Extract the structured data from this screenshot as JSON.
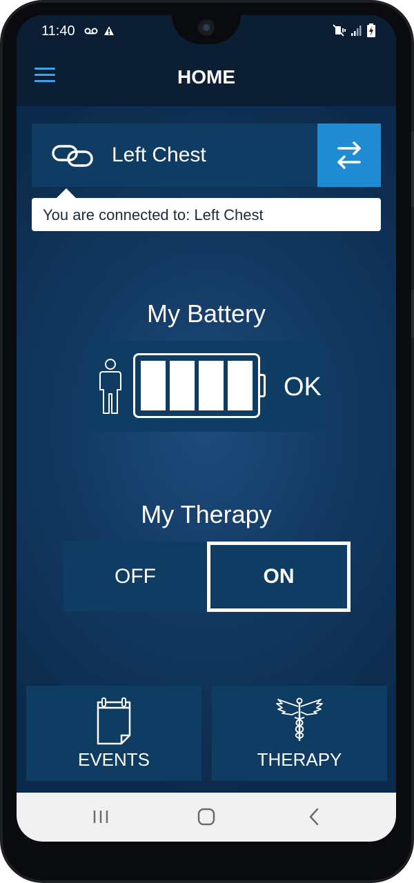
{
  "status_bar": {
    "time": "11:40",
    "left_icons": [
      "voicemail-icon",
      "alert-icon"
    ],
    "right_icons": [
      "mute-vibrate-icon",
      "signal-icon",
      "battery-charging-icon"
    ]
  },
  "app_bar": {
    "title": "HOME",
    "menu_icon": "hamburger-menu-icon"
  },
  "device": {
    "icon": "link-icon",
    "name": "Left Chest",
    "swap_icon": "swap-arrows-icon",
    "tooltip": "You are connected to: Left Chest"
  },
  "battery": {
    "title": "My Battery",
    "person_icon": "person-icon",
    "level_fraction": 1.0,
    "cells_filled": 4,
    "cells_total": 4,
    "status": "OK"
  },
  "therapy": {
    "title": "My Therapy",
    "off_label": "OFF",
    "on_label": "ON",
    "selected": "ON"
  },
  "tiles": [
    {
      "label": "EVENTS",
      "icon": "calendar-icon"
    },
    {
      "label": "THERAPY",
      "icon": "caduceus-icon"
    }
  ],
  "system_nav": [
    "recent-apps-icon",
    "home-icon",
    "back-icon"
  ],
  "colors": {
    "app_bar_bg": "#0b1e33",
    "panel_bg": "#0f3c63",
    "accent_blue": "#1f8bd3",
    "menu_icon": "#3da4e8",
    "text": "#ffffff"
  }
}
